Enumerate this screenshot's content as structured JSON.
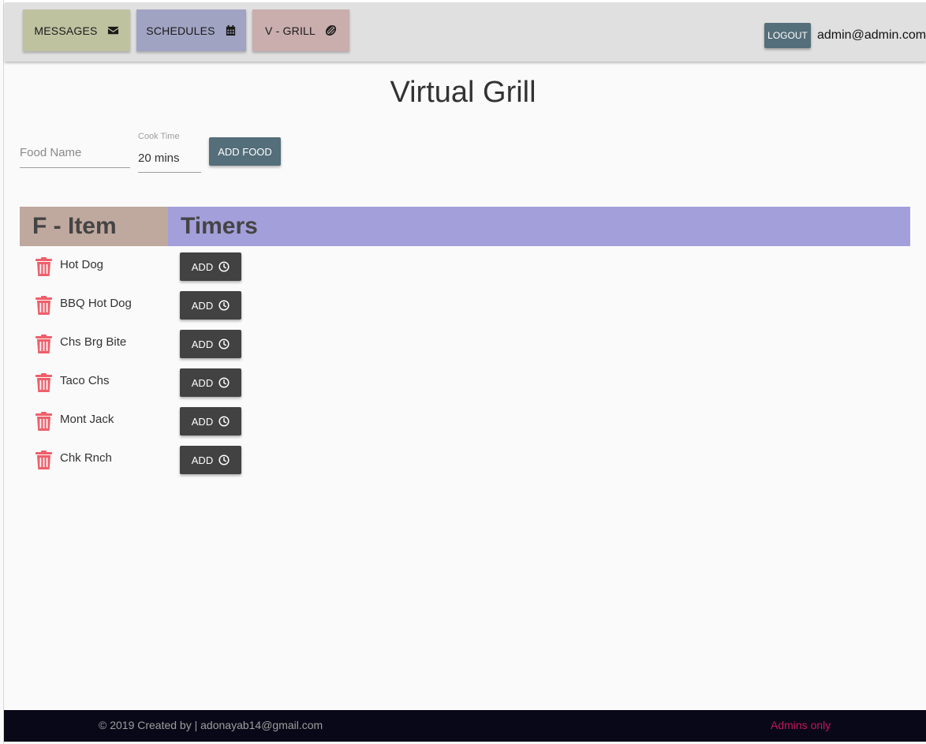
{
  "nav": {
    "messages": "MESSAGES",
    "schedules": "SCHEDULES",
    "vgrill": "V - GRILL",
    "logout": "LOGOUT",
    "user_email": "admin@admin.com"
  },
  "page_title": "Virtual Grill",
  "form": {
    "food_name_placeholder": "Food Name",
    "cook_time_label": "Cook Time",
    "cook_time_value": "20 mins",
    "add_food": "ADD FOOD"
  },
  "table": {
    "col_item": "F - Item",
    "col_timers": "Timers",
    "add_label": "ADD",
    "rows": [
      {
        "name": "Hot Dog"
      },
      {
        "name": "BBQ Hot Dog"
      },
      {
        "name": "Chs Brg Bite"
      },
      {
        "name": "Taco Chs"
      },
      {
        "name": "Mont Jack"
      },
      {
        "name": "Chk Rnch"
      }
    ]
  },
  "footer": {
    "copyright": "© 2019 Created by | adonayab14@gmail.com",
    "admins": "Admins only"
  },
  "colors": {
    "messages_bg": "#bfc29f",
    "schedules_bg": "#a1a3c3",
    "vgrill_bg": "#caadad",
    "item_header_bg": "#bfa89e",
    "timers_header_bg": "#a39fda",
    "trash": "#ef5f6a",
    "accent_button": "#546e7a",
    "dark_button": "#424242",
    "footer_bg": "#090818",
    "admins_text": "#c2185b"
  },
  "icons": {
    "messages": "envelope-icon",
    "schedules": "calendar-icon",
    "vgrill": "grill-icon",
    "delete": "trash-icon",
    "timer": "clock-icon"
  }
}
